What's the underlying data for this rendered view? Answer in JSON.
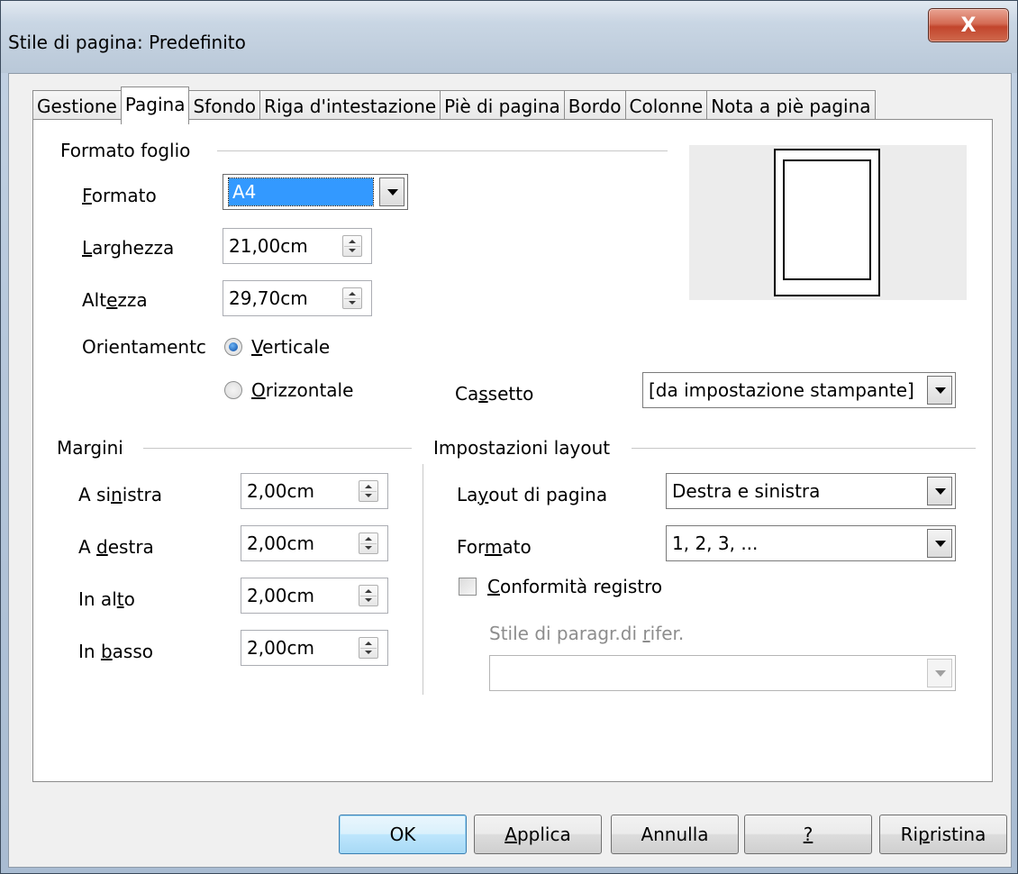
{
  "window": {
    "title": "Stile di pagina: Predefinito",
    "close_label": "X"
  },
  "tabs": [
    {
      "label": "Gestione"
    },
    {
      "label": "Pagina",
      "active": true
    },
    {
      "label": "Sfondo"
    },
    {
      "label": "Riga d'intestazione"
    },
    {
      "label": "Piè di pagina"
    },
    {
      "label": "Bordo"
    },
    {
      "label": "Colonne"
    },
    {
      "label": "Nota a piè pagina"
    }
  ],
  "paper": {
    "group_label": "Formato foglio",
    "format": {
      "label_pre": "",
      "label_mn": "F",
      "label_post": "ormato",
      "value": "A4"
    },
    "width": {
      "label_pre": "",
      "label_mn": "L",
      "label_post": "arghezza",
      "value": "21,00cm"
    },
    "height": {
      "label_pre": "Alt",
      "label_mn": "e",
      "label_post": "zza",
      "value": "29,70cm"
    },
    "orientation": {
      "label": "Orientamentc",
      "portrait": {
        "label_mn": "V",
        "label_post": "erticale",
        "checked": true
      },
      "landscape": {
        "label_mn": "O",
        "label_post": "rizzontale",
        "checked": false
      }
    },
    "tray": {
      "label_pre": "Ca",
      "label_mn": "s",
      "label_post": "setto",
      "value": "[da impostazione stampante]"
    }
  },
  "margins": {
    "group_label": "Margini",
    "left": {
      "label_pre": "A si",
      "label_mn": "n",
      "label_post": "istra",
      "value": "2,00cm"
    },
    "right": {
      "label_pre": "A ",
      "label_mn": "d",
      "label_post": "estra",
      "value": "2,00cm"
    },
    "top": {
      "label_pre": "In al",
      "label_mn": "t",
      "label_post": "o",
      "value": "2,00cm"
    },
    "bottom": {
      "label_pre": "In ",
      "label_mn": "b",
      "label_post": "asso",
      "value": "2,00cm"
    }
  },
  "layout": {
    "group_label": "Impostazioni layout",
    "page_layout": {
      "label_pre": "La",
      "label_mn": "y",
      "label_post": "out di pagina",
      "value": "Destra e sinistra"
    },
    "format": {
      "label_pre": "For",
      "label_mn": "m",
      "label_post": "ato",
      "value": "1, 2, 3, ..."
    },
    "register_true": {
      "label_mn": "C",
      "label_post": "onformità registro",
      "checked": false
    },
    "ref_style": {
      "label_pre": "Stile di paragr.di ",
      "label_mn": "r",
      "label_post": "ifer.",
      "value": ""
    }
  },
  "buttons": {
    "ok": "OK",
    "apply": {
      "pre": "",
      "mn": "A",
      "post": "pplica"
    },
    "cancel": "Annulla",
    "help": {
      "pre": "",
      "mn": "?",
      "post": ""
    },
    "reset": {
      "pre": "Ri",
      "mn": "p",
      "post": "ristina"
    }
  },
  "colors": {
    "accent": "#3399ff",
    "selection": "#3399ff",
    "close": "#c2452c"
  }
}
